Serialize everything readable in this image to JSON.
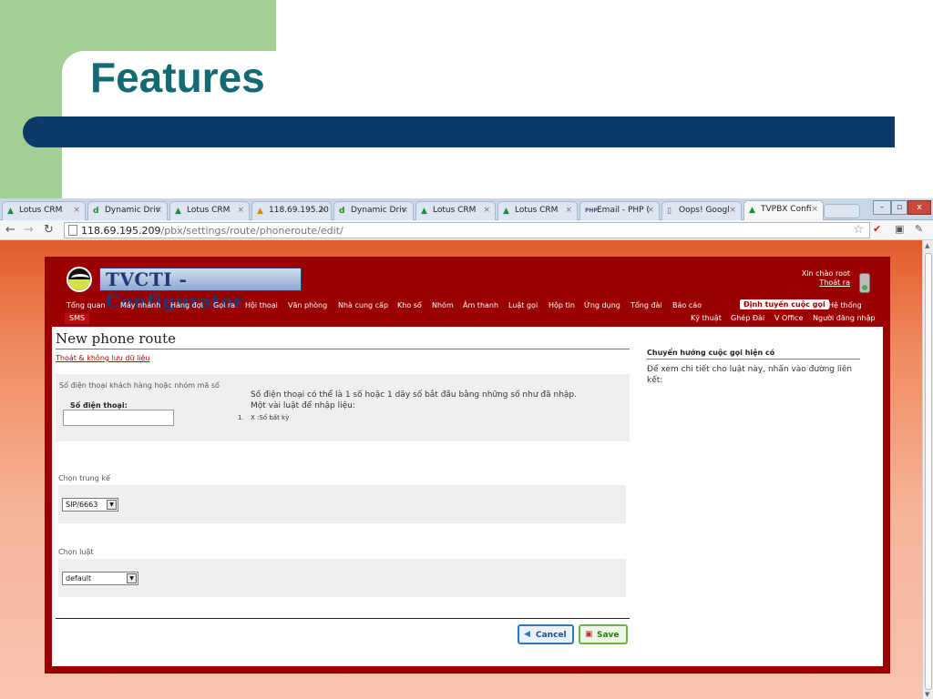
{
  "slide": {
    "title": "Features"
  },
  "browser": {
    "tabs": [
      {
        "label": "Lotus CRM",
        "icon": "lotus-icon"
      },
      {
        "label": "Dynamic Driv",
        "icon": "dynamic-drive-icon"
      },
      {
        "label": "Lotus CRM",
        "icon": "lotus-icon"
      },
      {
        "label": "118.69.195.20",
        "icon": "pma-icon"
      },
      {
        "label": "Dynamic Driv",
        "icon": "dynamic-drive-icon"
      },
      {
        "label": "Lotus CRM",
        "icon": "lotus-icon"
      },
      {
        "label": "Lotus CRM",
        "icon": "lotus-icon"
      },
      {
        "label": "Email - PHP (",
        "icon": "php-icon"
      },
      {
        "label": "Oops! Googl",
        "icon": "page-icon"
      },
      {
        "label": "TVPBX Confi",
        "icon": "lotus-icon",
        "active": true
      }
    ],
    "url_host": "118.69.195.209",
    "url_path": "/pbx/settings/route/phoneroute/edit/"
  },
  "app": {
    "logo_text": "TVCTI - Configurator",
    "greeting": "Xin chào root",
    "logout": "Thoát ra",
    "menu": [
      "Tổng quan",
      "Máy nhánh",
      "Hàng đợi",
      "Gọi ra",
      "Hội thoại",
      "Văn phòng",
      "Nhà cung cấp",
      "Kho số",
      "Nhóm",
      "Âm thanh",
      "Luật gọi",
      "Hộp tin",
      "Ứng dụng",
      "Tổng đài",
      "Báo cáo"
    ],
    "menu_active": "Định tuyến cuộc gọi",
    "menu_last": "Hệ thống",
    "sms": "SMS",
    "submenu": [
      "Kỹ thuật",
      "Ghép Đài",
      "V Office",
      "Người đăng nhập"
    ]
  },
  "form": {
    "title": "New phone route",
    "exit_link": "Thoát & không lưu dữ liệu",
    "section_label": "Số điện thoại khách hàng hoặc nhóm mã số",
    "phone_label": "Số điện thoại:",
    "phone_value": "",
    "help_line1": "Số điện thoại có thể là 1 số hoặc 1 dãy số bắt đầu bằng những số như đã nhập.",
    "help_line2": "Một vài luật để nhập liệu:",
    "help_num": "1.",
    "help_rule": "X :Số bất kỳ",
    "trunk_label": "Chọn trung kế",
    "trunk_value": "SIP/6663",
    "rule_label": "Chọn luật",
    "rule_value": "default",
    "cancel": "Cancel",
    "save": "Save"
  },
  "sidebar": {
    "title": "Chuyển hướng cuộc gọi hiện có",
    "text": "Để xem chi tiết cho luật này, nhấn vào đường liên kết:"
  }
}
